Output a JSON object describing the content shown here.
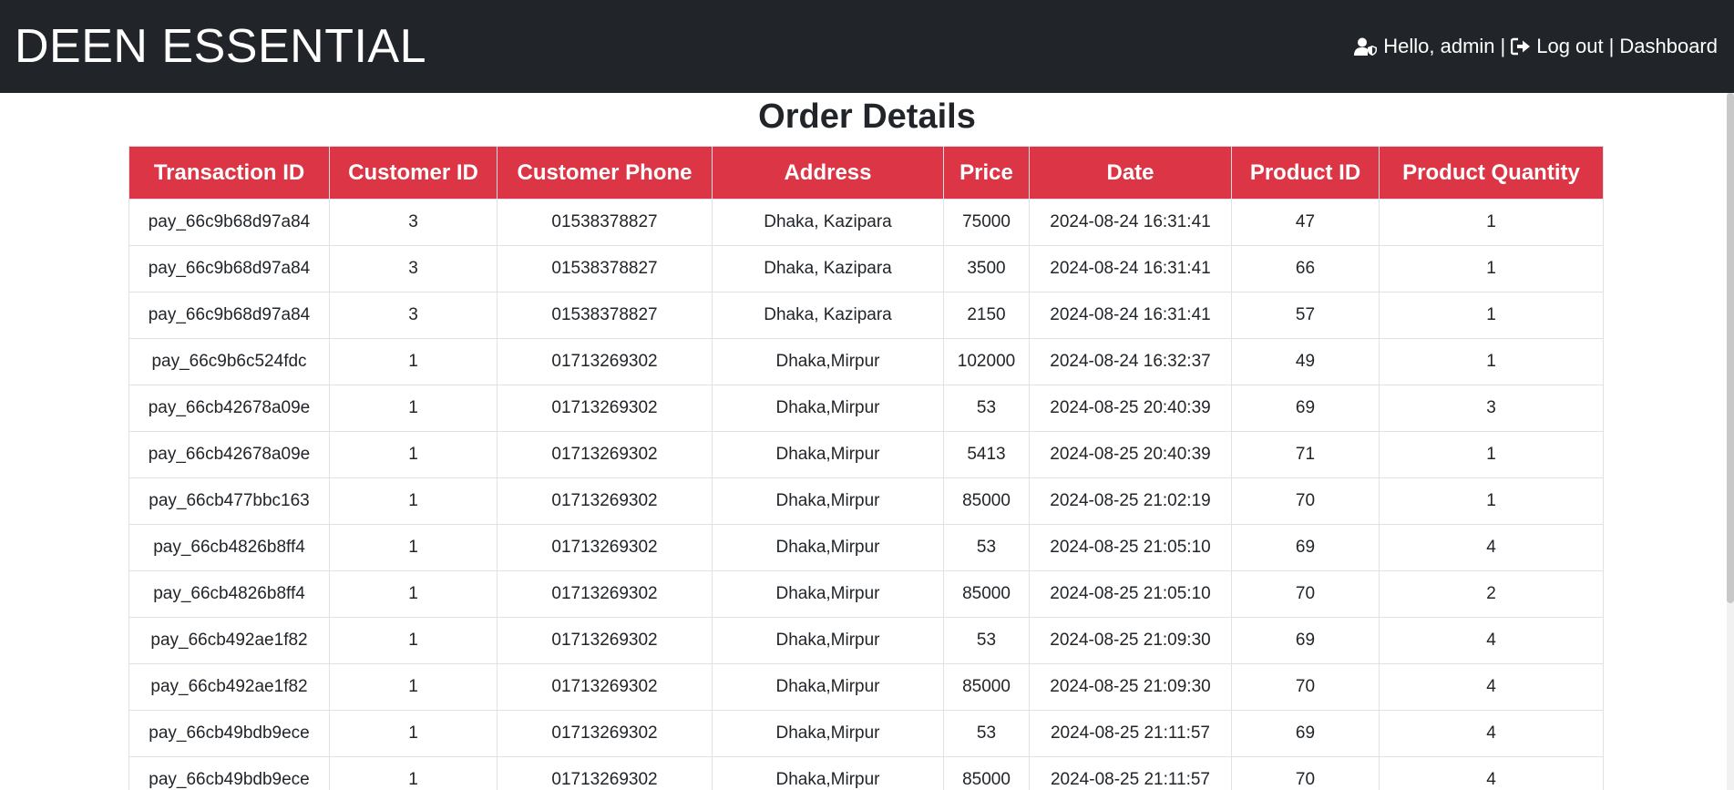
{
  "header": {
    "brand": "DEEN ESSENTIAL",
    "greeting": "Hello, admin",
    "separator_1": "|",
    "logout_label": "Log out",
    "separator_2": "|",
    "dashboard_label": "Dashboard",
    "user_icon": "user-shield-icon",
    "logout_icon": "sign-out-icon"
  },
  "page": {
    "title": "Order Details"
  },
  "colors": {
    "navbar_bg": "#212529",
    "table_header_bg": "#dc3545",
    "text": "#212529"
  },
  "table": {
    "columns": [
      "Transaction ID",
      "Customer ID",
      "Customer Phone",
      "Address",
      "Price",
      "Date",
      "Product ID",
      "Product Quantity"
    ],
    "rows": [
      [
        "pay_66c9b68d97a84",
        "3",
        "01538378827",
        "Dhaka, Kazipara",
        "75000",
        "2024-08-24 16:31:41",
        "47",
        "1"
      ],
      [
        "pay_66c9b68d97a84",
        "3",
        "01538378827",
        "Dhaka, Kazipara",
        "3500",
        "2024-08-24 16:31:41",
        "66",
        "1"
      ],
      [
        "pay_66c9b68d97a84",
        "3",
        "01538378827",
        "Dhaka, Kazipara",
        "2150",
        "2024-08-24 16:31:41",
        "57",
        "1"
      ],
      [
        "pay_66c9b6c524fdc",
        "1",
        "01713269302",
        "Dhaka,Mirpur",
        "102000",
        "2024-08-24 16:32:37",
        "49",
        "1"
      ],
      [
        "pay_66cb42678a09e",
        "1",
        "01713269302",
        "Dhaka,Mirpur",
        "53",
        "2024-08-25 20:40:39",
        "69",
        "3"
      ],
      [
        "pay_66cb42678a09e",
        "1",
        "01713269302",
        "Dhaka,Mirpur",
        "5413",
        "2024-08-25 20:40:39",
        "71",
        "1"
      ],
      [
        "pay_66cb477bbc163",
        "1",
        "01713269302",
        "Dhaka,Mirpur",
        "85000",
        "2024-08-25 21:02:19",
        "70",
        "1"
      ],
      [
        "pay_66cb4826b8ff4",
        "1",
        "01713269302",
        "Dhaka,Mirpur",
        "53",
        "2024-08-25 21:05:10",
        "69",
        "4"
      ],
      [
        "pay_66cb4826b8ff4",
        "1",
        "01713269302",
        "Dhaka,Mirpur",
        "85000",
        "2024-08-25 21:05:10",
        "70",
        "2"
      ],
      [
        "pay_66cb492ae1f82",
        "1",
        "01713269302",
        "Dhaka,Mirpur",
        "53",
        "2024-08-25 21:09:30",
        "69",
        "4"
      ],
      [
        "pay_66cb492ae1f82",
        "1",
        "01713269302",
        "Dhaka,Mirpur",
        "85000",
        "2024-08-25 21:09:30",
        "70",
        "4"
      ],
      [
        "pay_66cb49bdb9ece",
        "1",
        "01713269302",
        "Dhaka,Mirpur",
        "53",
        "2024-08-25 21:11:57",
        "69",
        "4"
      ],
      [
        "pay_66cb49bdb9ece",
        "1",
        "01713269302",
        "Dhaka,Mirpur",
        "85000",
        "2024-08-25 21:11:57",
        "70",
        "4"
      ]
    ]
  }
}
